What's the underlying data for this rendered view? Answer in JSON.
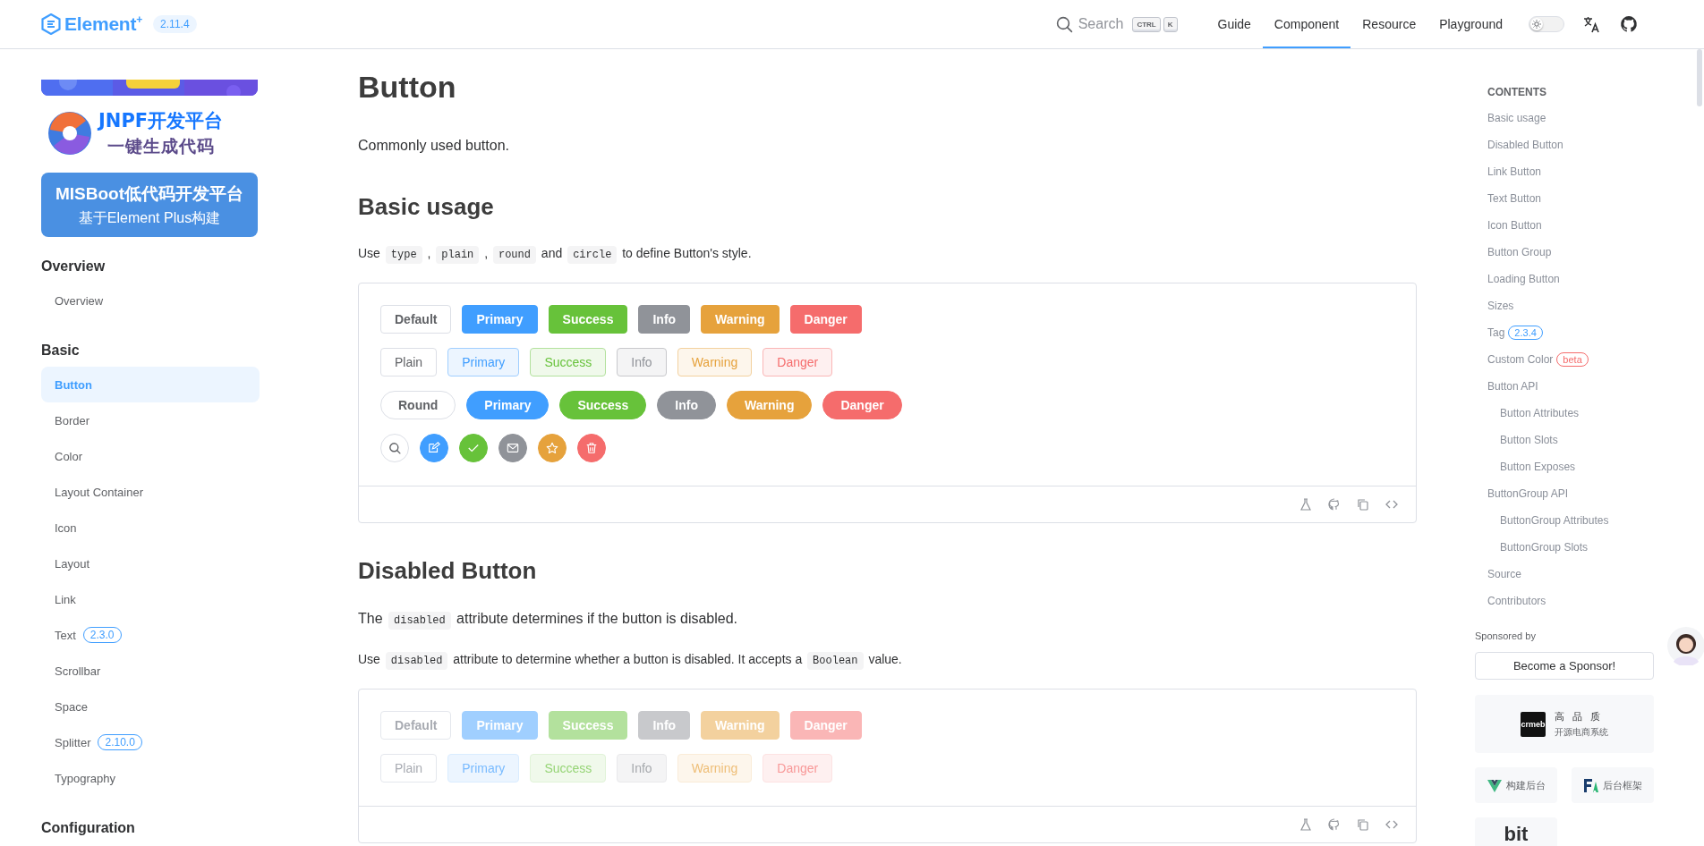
{
  "header": {
    "logo": "Element$^{+}$",
    "version": "2.11.4",
    "search": {
      "label": "Search",
      "keys": [
        "CTRL",
        "K"
      ]
    },
    "nav": [
      {
        "label": "Guide",
        "selected": false
      },
      {
        "label": "Component",
        "selected": true
      },
      {
        "label": "Resource",
        "selected": false
      },
      {
        "label": "Playground",
        "selected": false
      }
    ],
    "theme_switch": {
      "on": false
    }
  },
  "sidebar": {
    "ads": [
      {
        "kind": "picture"
      },
      {
        "kind": "logo_ad",
        "lines": [
          "JNPF开发平台",
          "一键生成代码"
        ]
      },
      {
        "kind": "banner",
        "lines": [
          "MISBoot低代码开发平台",
          "基于Element Plus构建"
        ]
      }
    ],
    "groups": [
      {
        "title": "Overview",
        "items": [
          {
            "label": "Overview",
            "selected": false
          }
        ]
      },
      {
        "title": "Basic",
        "items": [
          {
            "label": "Button",
            "selected": true
          },
          {
            "label": "Border",
            "selected": false
          },
          {
            "label": "Color",
            "selected": false
          },
          {
            "label": "Layout Container",
            "selected": false
          },
          {
            "label": "Icon",
            "selected": false
          },
          {
            "label": "Layout",
            "selected": false
          },
          {
            "label": "Link",
            "selected": false
          },
          {
            "label": "Text",
            "selected": false,
            "badge": "2.3.0"
          },
          {
            "label": "Scrollbar",
            "selected": false
          },
          {
            "label": "Space",
            "selected": false
          },
          {
            "label": "Splitter",
            "selected": false,
            "badge": "2.10.0"
          },
          {
            "label": "Typography",
            "selected": false
          }
        ]
      },
      {
        "title": "Configuration"
      }
    ]
  },
  "main": {
    "title": "Button",
    "description": "Commonly used button.",
    "sections": [
      {
        "heading": "Basic usage",
        "paragraphs": [
          {
            "kind": "body",
            "parts": [
              {
                "kind": "text",
                "text": "Use "
              },
              {
                "kind": "code",
                "text": "type"
              },
              {
                "kind": "text",
                "text": " , "
              },
              {
                "kind": "code",
                "text": "plain"
              },
              {
                "kind": "text",
                "text": " , "
              },
              {
                "kind": "code",
                "text": "round"
              },
              {
                "kind": "text",
                "text": " and "
              },
              {
                "kind": "code",
                "text": "circle"
              },
              {
                "kind": "text",
                "text": " to define Button's style."
              }
            ]
          }
        ],
        "demo": {
          "rows": [
            {
              "kind": "default",
              "buttons": [
                {
                  "label": "Default",
                  "kind": "default",
                  "disabled": false
                },
                {
                  "label": "Primary",
                  "kind": "primary",
                  "disabled": false
                },
                {
                  "label": "Success",
                  "kind": "success",
                  "disabled": false
                },
                {
                  "label": "Info",
                  "kind": "info",
                  "disabled": false
                },
                {
                  "label": "Warning",
                  "kind": "warning",
                  "disabled": false
                },
                {
                  "label": "Danger",
                  "kind": "danger",
                  "disabled": false
                }
              ]
            },
            {
              "kind": "plain",
              "buttons": [
                {
                  "label": "Plain",
                  "kind": "default",
                  "disabled": false
                },
                {
                  "label": "Primary",
                  "kind": "primary",
                  "disabled": false
                },
                {
                  "label": "Success",
                  "kind": "success",
                  "disabled": false
                },
                {
                  "label": "Info",
                  "kind": "info",
                  "disabled": false
                },
                {
                  "label": "Warning",
                  "kind": "warning",
                  "disabled": false
                },
                {
                  "label": "Danger",
                  "kind": "danger",
                  "disabled": false
                }
              ]
            },
            {
              "kind": "round",
              "buttons": [
                {
                  "label": "Round",
                  "kind": "default",
                  "disabled": false
                },
                {
                  "label": "Primary",
                  "kind": "primary",
                  "disabled": false
                },
                {
                  "label": "Success",
                  "kind": "success",
                  "disabled": false
                },
                {
                  "label": "Info",
                  "kind": "info",
                  "disabled": false
                },
                {
                  "label": "Warning",
                  "kind": "warning",
                  "disabled": false
                },
                {
                  "label": "Danger",
                  "kind": "danger",
                  "disabled": false
                }
              ]
            },
            {
              "kind": "circle",
              "buttons": [
                {
                  "kind": "default",
                  "disabled": false
                },
                {
                  "kind": "primary",
                  "disabled": false
                },
                {
                  "kind": "success",
                  "disabled": false
                },
                {
                  "kind": "info",
                  "disabled": false
                },
                {
                  "kind": "warning",
                  "disabled": false
                },
                {
                  "kind": "danger",
                  "disabled": false
                }
              ]
            }
          ]
        }
      },
      {
        "heading": "Disabled Button",
        "paragraphs": [
          {
            "kind": "lead",
            "parts": [
              {
                "kind": "text",
                "text": "The "
              },
              {
                "kind": "code",
                "text": "disabled"
              },
              {
                "kind": "text",
                "text": " attribute determines if the button is disabled."
              }
            ]
          },
          {
            "kind": "body",
            "parts": [
              {
                "kind": "text",
                "text": "Use "
              },
              {
                "kind": "code",
                "text": "disabled"
              },
              {
                "kind": "text",
                "text": " attribute to determine whether a button is disabled. It accepts a "
              },
              {
                "kind": "code",
                "text": "Boolean"
              },
              {
                "kind": "text",
                "text": " value."
              }
            ]
          }
        ],
        "demo": {
          "rows": [
            {
              "kind": "default",
              "buttons": [
                {
                  "label": "Default",
                  "kind": "default",
                  "disabled": true
                },
                {
                  "label": "Primary",
                  "kind": "primary",
                  "disabled": true
                },
                {
                  "label": "Success",
                  "kind": "success",
                  "disabled": true
                },
                {
                  "label": "Info",
                  "kind": "info",
                  "disabled": true
                },
                {
                  "label": "Warning",
                  "kind": "warning",
                  "disabled": true
                },
                {
                  "label": "Danger",
                  "kind": "danger",
                  "disabled": true
                }
              ]
            },
            {
              "kind": "plain",
              "buttons": [
                {
                  "label": "Plain",
                  "kind": "default",
                  "disabled": true
                },
                {
                  "label": "Primary",
                  "kind": "primary",
                  "disabled": true
                },
                {
                  "label": "Success",
                  "kind": "success",
                  "disabled": true
                },
                {
                  "label": "Info",
                  "kind": "info",
                  "disabled": true
                },
                {
                  "label": "Warning",
                  "kind": "warning",
                  "disabled": true
                },
                {
                  "label": "Danger",
                  "kind": "danger",
                  "disabled": true
                }
              ]
            }
          ]
        }
      }
    ]
  },
  "toc": {
    "title": "CONTENTS",
    "items": [
      {
        "label": "Basic usage"
      },
      {
        "label": "Disabled Button"
      },
      {
        "label": "Link Button"
      },
      {
        "label": "Text Button"
      },
      {
        "label": "Icon Button"
      },
      {
        "label": "Button Group"
      },
      {
        "label": "Loading Button"
      },
      {
        "label": "Sizes"
      },
      {
        "label": "Tag",
        "badge": {
          "text": "2.3.4",
          "color": "#409eff"
        }
      },
      {
        "label": "Custom Color",
        "badge": {
          "text": "beta",
          "color": "#f56c6c"
        }
      },
      {
        "label": "Button API",
        "children": [
          {
            "label": "Button Attributes"
          },
          {
            "label": "Button Slots"
          },
          {
            "label": "Button Exposes"
          }
        ]
      },
      {
        "label": "ButtonGroup API",
        "children": [
          {
            "label": "ButtonGroup Attributes"
          },
          {
            "label": "ButtonGroup Slots"
          }
        ]
      },
      {
        "label": "Source"
      },
      {
        "label": "Contributors"
      }
    ],
    "sponsors": {
      "title": "Sponsored by",
      "button": "Become a Sponsor!",
      "cards": [
        {
          "kind": "wide",
          "logo": "crmeb",
          "lines": [
            "高 品 质",
            "开源电商系统"
          ]
        },
        {
          "kind": "half",
          "lines": [
            "构建后台"
          ]
        },
        {
          "kind": "half",
          "lines": [
            "后台框架"
          ]
        },
        {
          "kind": "half",
          "lines": [
            "bit"
          ]
        }
      ]
    }
  }
}
